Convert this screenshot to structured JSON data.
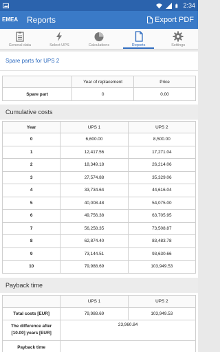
{
  "status_bar": {
    "time": "2:34",
    "image_icon": "image-icon",
    "wifi_icon": "wifi-icon",
    "signal_icon": "signal-icon",
    "battery_icon": "battery-icon"
  },
  "action_bar": {
    "brand": "EMEA",
    "title": "Reports",
    "export_label": "Export PDF",
    "export_icon": "document-icon"
  },
  "tabs": [
    {
      "label": "General data",
      "icon": "clipboard-icon",
      "active": false
    },
    {
      "label": "Select UPS",
      "icon": "lightning-icon",
      "active": false
    },
    {
      "label": "Calculations",
      "icon": "pie-chart-icon",
      "active": false
    },
    {
      "label": "Reports",
      "icon": "document-icon",
      "active": true
    },
    {
      "label": "Settings",
      "icon": "gear-icon",
      "active": false
    }
  ],
  "spare_parts": {
    "title": "Spare parts for UPS 2",
    "headers": [
      "",
      "Year of replacement",
      "Price"
    ],
    "row": {
      "label": "Spare part",
      "year": "0",
      "price": "0.00"
    }
  },
  "cumulative": {
    "title": "Cumulative costs",
    "headers": [
      "Year",
      "UPS 1",
      "UPS 2"
    ],
    "rows": [
      [
        "0",
        "6,600.00",
        "8,500.00"
      ],
      [
        "1",
        "12,417.56",
        "17,271.04"
      ],
      [
        "2",
        "18,349.18",
        "26,214.06"
      ],
      [
        "3",
        "27,574.88",
        "35,329.06"
      ],
      [
        "4",
        "33,734.64",
        "44,616.04"
      ],
      [
        "5",
        "40,008.48",
        "54,075.00"
      ],
      [
        "6",
        "49,756.38",
        "63,705.95"
      ],
      [
        "7",
        "56,258.35",
        "73,508.87"
      ],
      [
        "8",
        "62,874.40",
        "83,483.78"
      ],
      [
        "9",
        "73,144.51",
        "93,630.66"
      ],
      [
        "10",
        "79,988.69",
        "103,949.53"
      ]
    ]
  },
  "payback": {
    "title": "Payback time",
    "headers": [
      "",
      "UPS 1",
      "UPS 2"
    ],
    "total_label": "Total costs [EUR]",
    "total_ups1": "79,988.69",
    "total_ups2": "103,949.53",
    "difference_label": "The difference after [10.00] years [EUR]",
    "difference_value": "23,960.84",
    "payback_label": "Payback time",
    "payback_value": ""
  },
  "colors": {
    "status_bar": "#2b63ad",
    "action_bar": "#3a7ac7",
    "accent": "#2f6cc0"
  }
}
